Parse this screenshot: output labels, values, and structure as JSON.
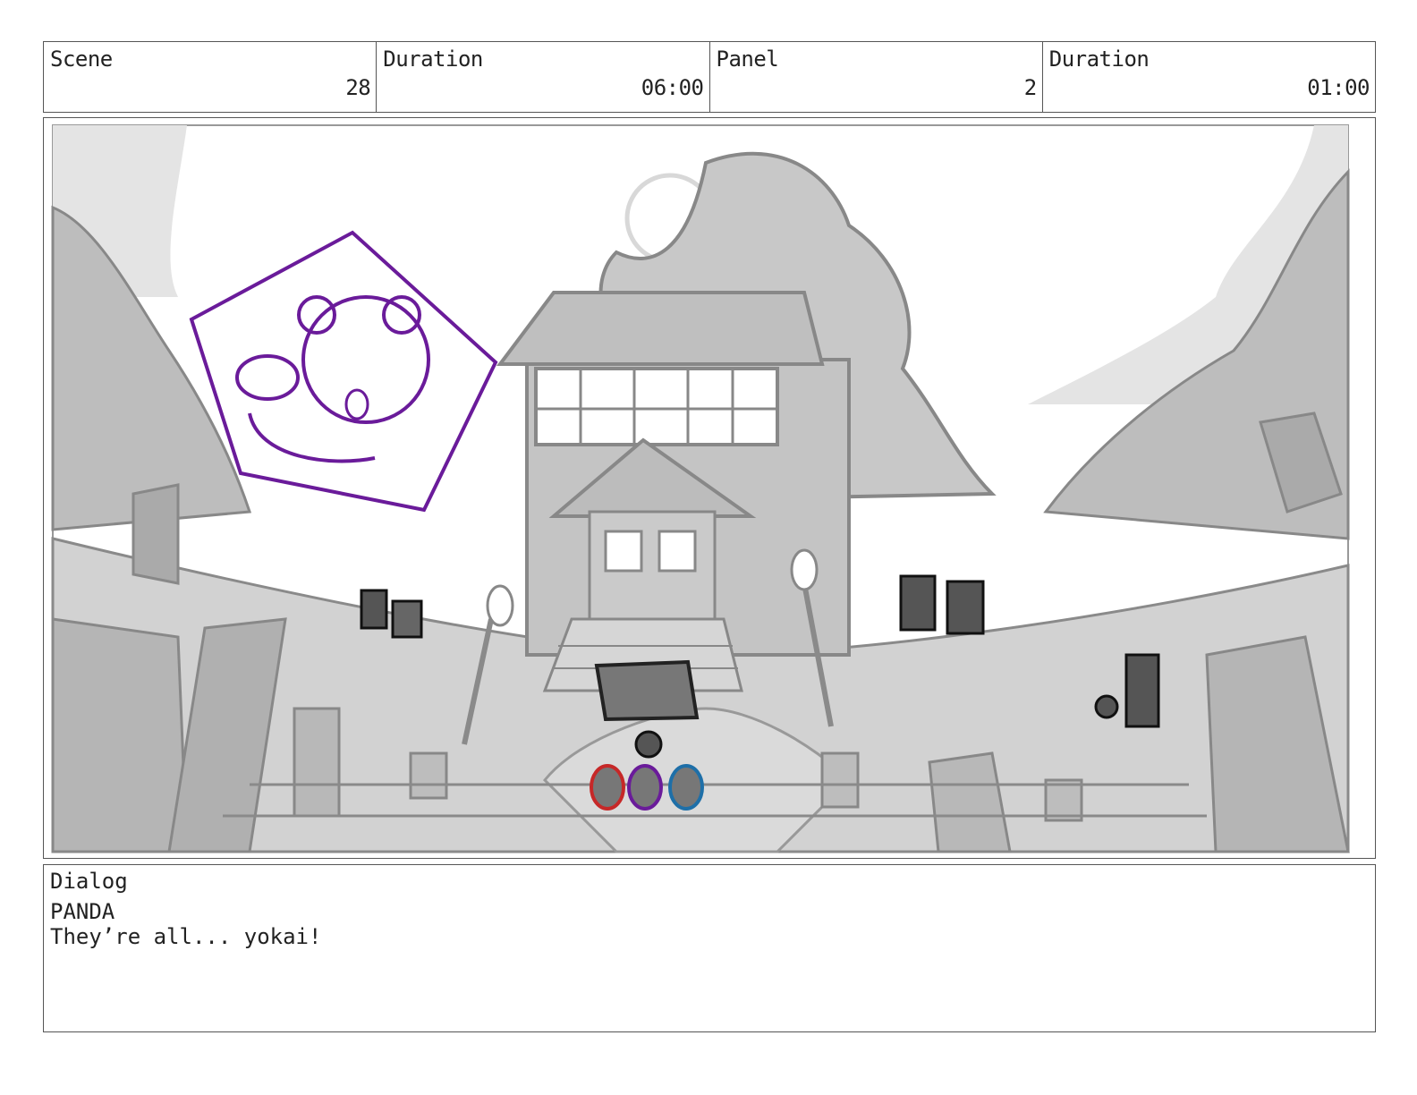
{
  "header": {
    "scene_label": "Scene",
    "scene_value": "28",
    "scene_duration_label": "Duration",
    "scene_duration_value": "06:00",
    "panel_label": "Panel",
    "panel_value": "2",
    "panel_duration_label": "Duration",
    "panel_duration_value": "01:00"
  },
  "panel_image": {
    "description_icon": "storyboard-sketch",
    "colors": {
      "sketch": "#8a8a8a",
      "fill": "#cfcfcf",
      "sky": "#ffffff",
      "purple": "#6a1b9a",
      "red": "#c62828",
      "blue": "#1e6fa8"
    }
  },
  "dialog": {
    "label": "Dialog",
    "speaker": "PANDA",
    "line": "They’re all... yokai!"
  }
}
